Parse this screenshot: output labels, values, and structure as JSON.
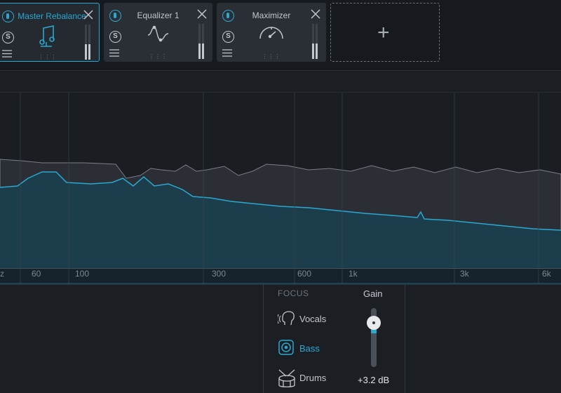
{
  "modules": [
    {
      "title": "Master Rebalance",
      "active": true,
      "icon": "rebalance-icon"
    },
    {
      "title": "Equalizer 1",
      "active": false,
      "icon": "eq-curve-icon"
    },
    {
      "title": "Maximizer",
      "active": false,
      "icon": "gauge-icon"
    }
  ],
  "add_module": "+",
  "solo_label": "S",
  "freq_labels": [
    "z",
    "60",
    "100",
    "300",
    "600",
    "1k",
    "3k",
    "6k"
  ],
  "focus": {
    "title": "FOCUS",
    "items": [
      {
        "label": "Vocals",
        "selected": false
      },
      {
        "label": "Bass",
        "selected": true
      },
      {
        "label": "Drums",
        "selected": false
      }
    ]
  },
  "gain": {
    "title": "Gain",
    "value": "+3.2 dB",
    "level": 0.55
  },
  "colors": {
    "accent": "#2aa8d0",
    "background": "#16191e"
  }
}
